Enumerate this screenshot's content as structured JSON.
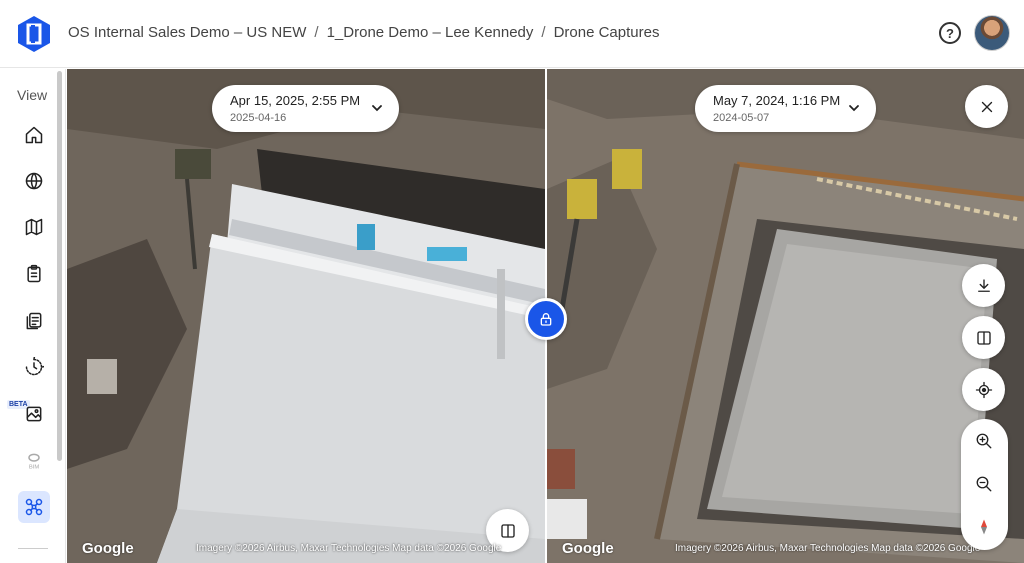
{
  "colors": {
    "accent": "#1a56e8",
    "accent_light": "#dbe6ff"
  },
  "breadcrumb": {
    "items": [
      "OS Internal Sales Demo – US NEW",
      "1_Drone Demo – Lee Kennedy",
      "Drone Captures"
    ],
    "separator": "/"
  },
  "header": {
    "help_icon": "question-circle-icon",
    "help_glyph": "?"
  },
  "sidebar": {
    "label": "View",
    "beta_badge": "BETA",
    "items": [
      {
        "name": "home",
        "icon": "home-icon"
      },
      {
        "name": "globe",
        "icon": "globe-icon"
      },
      {
        "name": "map",
        "icon": "map-icon"
      },
      {
        "name": "clipboard",
        "icon": "clipboard-icon"
      },
      {
        "name": "documents",
        "icon": "documents-icon"
      },
      {
        "name": "timeline",
        "icon": "clock-icon"
      },
      {
        "name": "images",
        "icon": "image-icon"
      },
      {
        "name": "bim",
        "icon": "bim-icon",
        "label": "BIM",
        "disabled": true
      },
      {
        "name": "drone",
        "icon": "drone-icon",
        "active": true
      }
    ]
  },
  "left_capture": {
    "date_main": "Apr 15, 2025, 2:55 PM",
    "date_sub": "2025-04-16"
  },
  "right_capture": {
    "date_main": "May 7, 2024, 1:16 PM",
    "date_sub": "2024-05-07"
  },
  "map": {
    "google_label": "Google",
    "attribution": "Imagery ©2026 Airbus, Maxar Technologies Map data ©2026 Google"
  }
}
